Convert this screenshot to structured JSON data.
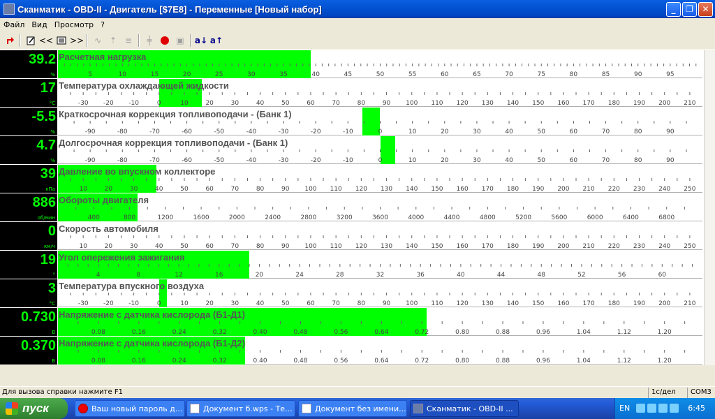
{
  "window": {
    "title": "Сканматик - OBD-II - Двигатель [$7E8] - Переменные [Новый набор]",
    "min_glyph": "_",
    "max_glyph": "❐",
    "close_glyph": "✕"
  },
  "menu": [
    "Файл",
    "Вид",
    "Просмотр",
    "?"
  ],
  "toolbar": {
    "prev_label": "<<",
    "next_label": ">>",
    "sort_asc_label": "a↓",
    "sort_desc_label": "a↑"
  },
  "gauges": [
    {
      "label": "Расчетная нагрузка",
      "value": "39.2",
      "unit": "%",
      "min": 0,
      "max": 100,
      "fill_from": 0,
      "fill_to": 39.2,
      "ticks": [
        5,
        10,
        15,
        20,
        25,
        30,
        35,
        40,
        45,
        50,
        55,
        60,
        65,
        70,
        75,
        80,
        85,
        90,
        95
      ],
      "minor": 1,
      "labels_start": 5
    },
    {
      "label": "Температура охлаждающей жидкости",
      "value": "17",
      "unit": "°C",
      "min": -40,
      "max": 215,
      "fill_from": 0,
      "fill_to": 17,
      "ticks": [
        -30,
        -20,
        -10,
        0,
        10,
        20,
        30,
        40,
        50,
        60,
        70,
        80,
        90,
        100,
        110,
        120,
        130,
        140,
        150,
        160,
        170,
        180,
        190,
        200,
        210
      ],
      "minor": 5
    },
    {
      "label": "Краткосрочная коррекция топливоподачи - (Банк 1)",
      "value": "-5.5",
      "unit": "%",
      "min": -100,
      "max": 100,
      "fill_from": -5.5,
      "fill_to": 0,
      "ticks": [
        -90,
        -80,
        -70,
        -60,
        -50,
        -40,
        -30,
        -20,
        -10,
        0,
        10,
        20,
        30,
        40,
        50,
        60,
        70,
        80,
        90
      ],
      "minor": 5
    },
    {
      "label": "Долгосрочная коррекция топливоподачи -  (Банк 1)",
      "value": "4.7",
      "unit": "%",
      "min": -100,
      "max": 100,
      "fill_from": 0,
      "fill_to": 4.7,
      "ticks": [
        -90,
        -80,
        -70,
        -60,
        -50,
        -40,
        -30,
        -20,
        -10,
        0,
        10,
        20,
        30,
        40,
        50,
        60,
        70,
        80,
        90
      ],
      "minor": 5
    },
    {
      "label": "Давление во впускном коллекторе",
      "value": "39",
      "unit": "кПа",
      "min": 0,
      "max": 255,
      "fill_from": 0,
      "fill_to": 39,
      "ticks": [
        10,
        20,
        30,
        40,
        50,
        60,
        70,
        80,
        90,
        100,
        110,
        120,
        130,
        140,
        150,
        160,
        170,
        180,
        190,
        200,
        210,
        220,
        230,
        240,
        250
      ],
      "minor": 5
    },
    {
      "label": "Обороты двигателя",
      "value": "886",
      "unit": "об/мин",
      "min": 0,
      "max": 7200,
      "fill_from": 0,
      "fill_to": 886,
      "ticks": [
        400,
        800,
        1200,
        1600,
        2000,
        2400,
        2800,
        3200,
        3600,
        4000,
        4400,
        4800,
        5200,
        5600,
        6000,
        6400,
        6800
      ],
      "minor": 200
    },
    {
      "label": "Скорость автомобиля",
      "value": "0",
      "unit": "км/ч",
      "min": 0,
      "max": 255,
      "fill_from": 0,
      "fill_to": 0,
      "ticks": [
        10,
        20,
        30,
        40,
        50,
        60,
        70,
        80,
        90,
        100,
        110,
        120,
        130,
        140,
        150,
        160,
        170,
        180,
        190,
        200,
        210,
        220,
        230,
        240,
        250
      ],
      "minor": 5
    },
    {
      "label": "Угол опережения зажигания",
      "value": "19",
      "unit": "°",
      "min": 0,
      "max": 64,
      "fill_from": 0,
      "fill_to": 19,
      "ticks": [
        4,
        8,
        12,
        16,
        20,
        24,
        28,
        32,
        36,
        40,
        44,
        48,
        52,
        56,
        60
      ],
      "minor": 1
    },
    {
      "label": "Температура впускного воздуха",
      "value": "3",
      "unit": "°C",
      "min": -40,
      "max": 215,
      "fill_from": 0,
      "fill_to": 3,
      "ticks": [
        -30,
        -20,
        -10,
        0,
        10,
        20,
        30,
        40,
        50,
        60,
        70,
        80,
        90,
        100,
        110,
        120,
        130,
        140,
        150,
        160,
        170,
        180,
        190,
        200,
        210
      ],
      "minor": 5
    },
    {
      "label": "Напряжение с датчика кислорода (Б1-Д1)",
      "value": "0.730",
      "unit": "В",
      "min": 0,
      "max": 1.275,
      "fill_from": 0,
      "fill_to": 0.73,
      "ticks": [
        0.08,
        0.16,
        0.24,
        0.32,
        0.4,
        0.48,
        0.56,
        0.64,
        0.72,
        0.8,
        0.88,
        0.96,
        1.04,
        1.12,
        1.2
      ],
      "minor": 0.04
    },
    {
      "label": "Напряжение с датчика кислорода (Б1-Д2)",
      "value": "0.370",
      "unit": "В",
      "min": 0,
      "max": 1.275,
      "fill_from": 0,
      "fill_to": 0.37,
      "ticks": [
        0.08,
        0.16,
        0.24,
        0.32,
        0.4,
        0.48,
        0.56,
        0.64,
        0.72,
        0.8,
        0.88,
        0.96,
        1.04,
        1.12,
        1.2
      ],
      "minor": 0.04
    }
  ],
  "status": {
    "help": "Для вызова справки нажмите F1",
    "rate": "1с/дел",
    "port": "COM3"
  },
  "taskbar": {
    "start_label": "пуск",
    "tasks": [
      {
        "label": "Ваш новый пароль д...",
        "icon": "opera-icon"
      },
      {
        "label": "Документ б.wps - Те...",
        "icon": "document-icon"
      },
      {
        "label": "Документ без имени...",
        "icon": "document-icon"
      },
      {
        "label": "Сканматик - OBD-II ...",
        "icon": "app-icon"
      }
    ],
    "lang": "EN",
    "time": "6:45"
  }
}
